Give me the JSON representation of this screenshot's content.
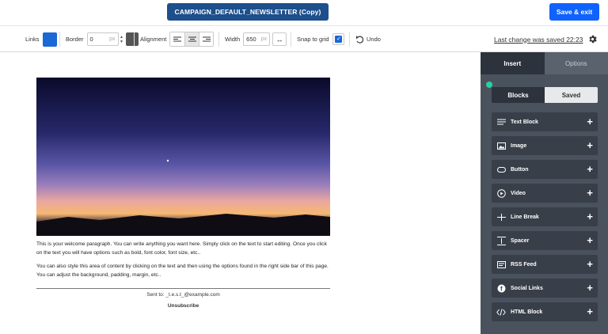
{
  "header": {
    "campaign_title": "CAMPAIGN_DEFAULT_NEWSLETTER (Copy)",
    "save_exit_label": "Save & exit"
  },
  "toolbar": {
    "links_label": "Links",
    "links_color": "#1c68d4",
    "border_label": "Border",
    "border_value": "0",
    "border_unit": "px",
    "border_color": "#555555",
    "alignment_label": "Alignment",
    "width_label": "Width",
    "width_value": "650",
    "width_unit": "px",
    "snap_label": "Snap to grid",
    "snap_checked": true,
    "undo_label": "Undo",
    "last_saved": "Last change was saved 22:23"
  },
  "email": {
    "paragraph_1": "This is your welcome paragraph. You can write anything you want here. Simply click on the text to start editing. Once you click on the text you will have options such as bold, font color, font size, etc..",
    "paragraph_2": "You can also style this area of content by clicking on the text and then using the options found in the right side bar of this page. You can adjust the background, padding, margin, etc..",
    "sent_to": "Sent to: _t.e.s.t_@example.com",
    "unsubscribe": "Unsubscribe"
  },
  "panel": {
    "tabs": [
      {
        "label": "Insert",
        "active": true
      },
      {
        "label": "Options",
        "active": false
      }
    ],
    "segments": [
      {
        "label": "Blocks",
        "active": true
      },
      {
        "label": "Saved",
        "active": false
      }
    ],
    "blocks": [
      {
        "label": "Text Block",
        "icon": "text-lines-icon"
      },
      {
        "label": "Image",
        "icon": "image-icon"
      },
      {
        "label": "Button",
        "icon": "button-icon"
      },
      {
        "label": "Video",
        "icon": "play-icon"
      },
      {
        "label": "Line Break",
        "icon": "line-break-icon"
      },
      {
        "label": "Spacer",
        "icon": "spacer-icon"
      },
      {
        "label": "RSS Feed",
        "icon": "rss-icon"
      },
      {
        "label": "Social Links",
        "icon": "facebook-icon"
      },
      {
        "label": "HTML Block",
        "icon": "code-icon"
      }
    ]
  },
  "colors": {
    "title_bg": "#1d4f8c",
    "save_bg": "#0f62fe",
    "panel_bg": "#4a525e",
    "block_bg": "#383f49",
    "accent_dot": "#27d1a0"
  }
}
